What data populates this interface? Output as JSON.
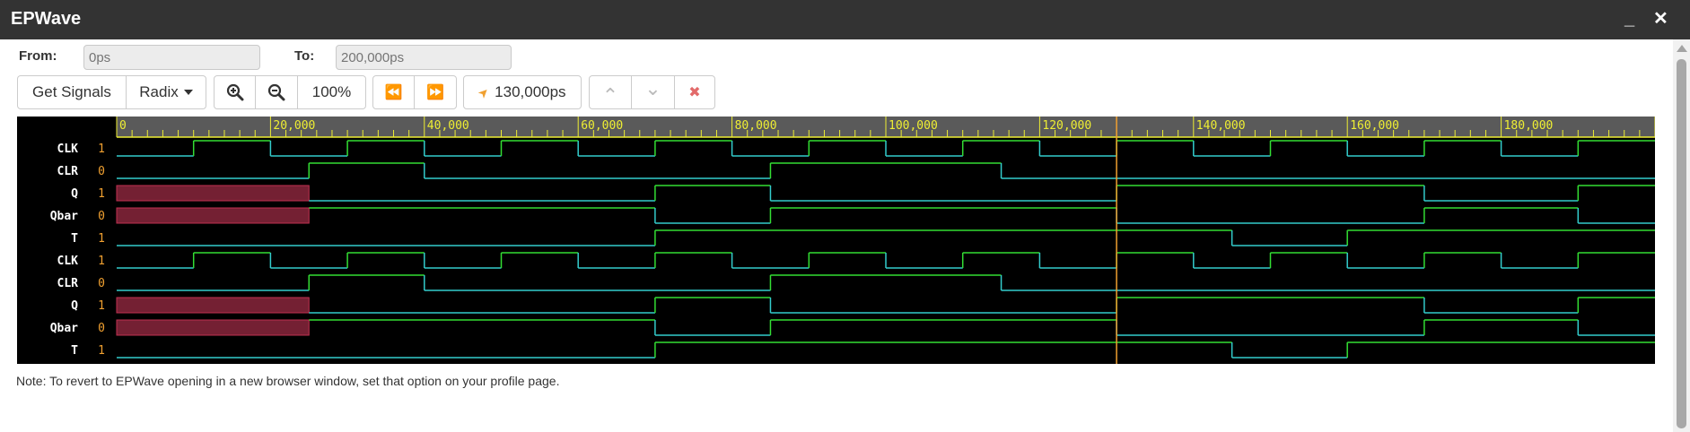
{
  "window": {
    "title": "EPWave",
    "minimize_glyph": "_",
    "close_glyph": "✕"
  },
  "range": {
    "from_label": "From:",
    "from_placeholder": "0ps",
    "to_label": "To:",
    "to_placeholder": "200,000ps"
  },
  "toolbar": {
    "get_signals": "Get Signals",
    "radix": "Radix",
    "zoom_in_icon": "zoom-in-icon",
    "zoom_out_icon": "zoom-out-icon",
    "zoom_level": "100%",
    "rewind_glyph": "⏪",
    "fast_forward_glyph": "⏩",
    "cursor_time": "130,000ps",
    "cursor_icon": "➤",
    "up_glyph": "⌃",
    "down_glyph": "⌄",
    "delete_glyph": "✖"
  },
  "colors": {
    "high": "#33dd33",
    "low": "#33cccc",
    "unknown": "#742033",
    "ruler": "#eeee33",
    "cursor": "#f0a030",
    "value": "#f0a030"
  },
  "timeline": {
    "tick_labels": [
      "0",
      "20,000",
      "40,000",
      "60,000",
      "80,000",
      "100,000",
      "120,000",
      "140,000",
      "160,000",
      "180,000"
    ],
    "tick_times_ps": [
      0,
      20000,
      40000,
      60000,
      80000,
      100000,
      120000,
      140000,
      160000,
      180000
    ],
    "window_ps": [
      0,
      200000
    ],
    "cursor_ps": 130000
  },
  "signals": [
    {
      "name": "CLK",
      "value": "1",
      "initial": 0,
      "edges": [
        10000,
        20000,
        30000,
        40000,
        50000,
        60000,
        70000,
        80000,
        90000,
        100000,
        110000,
        120000,
        130000,
        140000,
        150000,
        160000,
        170000,
        180000,
        190000,
        200000
      ]
    },
    {
      "name": "CLR",
      "value": "0",
      "initial": 0,
      "edges": [
        25000,
        40000,
        85000,
        115000
      ]
    },
    {
      "name": "Q",
      "value": "1",
      "unknown_until": 25000,
      "initial": 0,
      "edges": [
        70000,
        85000,
        130000,
        170000,
        190000
      ]
    },
    {
      "name": "Qbar",
      "value": "0",
      "unknown_until": 25000,
      "initial": 1,
      "edges": [
        70000,
        85000,
        130000,
        170000,
        190000
      ]
    },
    {
      "name": "T",
      "value": "1",
      "initial": 0,
      "edges": [
        70000,
        145000,
        160000
      ]
    },
    {
      "name": "CLK",
      "value": "1",
      "initial": 0,
      "edges": [
        10000,
        20000,
        30000,
        40000,
        50000,
        60000,
        70000,
        80000,
        90000,
        100000,
        110000,
        120000,
        130000,
        140000,
        150000,
        160000,
        170000,
        180000,
        190000,
        200000
      ]
    },
    {
      "name": "CLR",
      "value": "0",
      "initial": 0,
      "edges": [
        25000,
        40000,
        85000,
        115000
      ]
    },
    {
      "name": "Q",
      "value": "1",
      "unknown_until": 25000,
      "initial": 0,
      "edges": [
        70000,
        85000,
        130000,
        170000,
        190000
      ]
    },
    {
      "name": "Qbar",
      "value": "0",
      "unknown_until": 25000,
      "initial": 1,
      "edges": [
        70000,
        85000,
        130000,
        170000,
        190000
      ]
    },
    {
      "name": "T",
      "value": "1",
      "initial": 0,
      "edges": [
        70000,
        145000,
        160000
      ]
    }
  ],
  "note": "Note: To revert to EPWave opening in a new browser window, set that option on your profile page."
}
